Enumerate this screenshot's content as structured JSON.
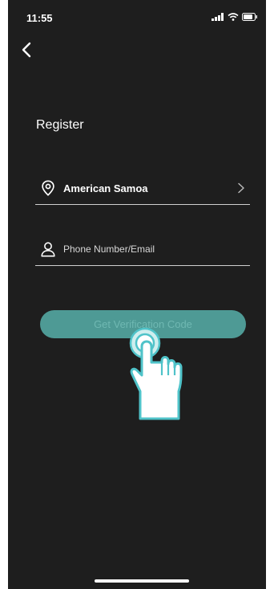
{
  "status_bar": {
    "time": "11:55",
    "icons": [
      "signal-icon",
      "wifi-icon",
      "battery-icon"
    ]
  },
  "nav": {
    "back_icon": "chevron-left-icon"
  },
  "page": {
    "title": "Register"
  },
  "form": {
    "region": {
      "icon": "location-pin-icon",
      "value": "American Samoa",
      "trailing_icon": "chevron-right-icon"
    },
    "account": {
      "icon": "user-icon",
      "value": "",
      "placeholder": "Phone Number/Email"
    },
    "submit_label": "Get Verification Code"
  },
  "colors": {
    "background": "#1e1e1e",
    "accent": "#4e9a95",
    "hand_outline": "#4fc3c9",
    "text": "#ffffff"
  }
}
